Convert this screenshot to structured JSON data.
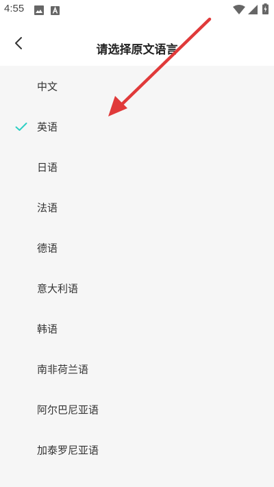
{
  "status_bar": {
    "time": "4:55",
    "icons": [
      "image-icon",
      "text-a-icon",
      "wifi-icon",
      "signal-icon",
      "battery-charging-icon"
    ]
  },
  "header": {
    "back_icon": "chevron-left-icon",
    "title": "请选择原文语言"
  },
  "languages": [
    {
      "label": "中文",
      "selected": false
    },
    {
      "label": "英语",
      "selected": true
    },
    {
      "label": "日语",
      "selected": false
    },
    {
      "label": "法语",
      "selected": false
    },
    {
      "label": "德语",
      "selected": false
    },
    {
      "label": "意大利语",
      "selected": false
    },
    {
      "label": "韩语",
      "selected": false
    },
    {
      "label": "南非荷兰语",
      "selected": false
    },
    {
      "label": "阿尔巴尼亚语",
      "selected": false
    },
    {
      "label": "加泰罗尼亚语",
      "selected": false
    }
  ],
  "colors": {
    "check": "#2ccfc4",
    "annotation_arrow": "#e03a3a",
    "list_background": "#f6f6f6"
  }
}
